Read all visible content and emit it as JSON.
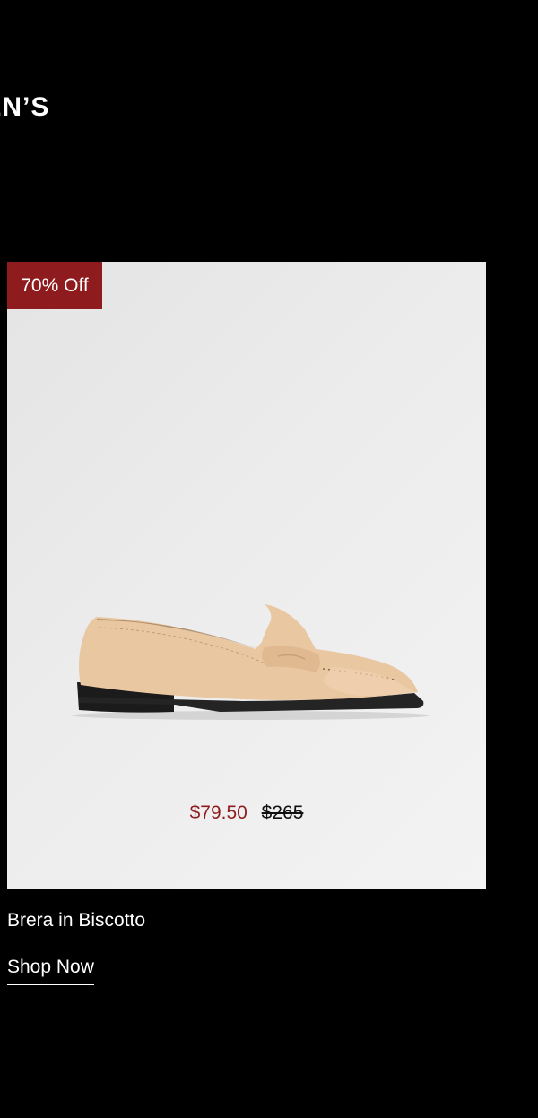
{
  "section": {
    "title": "IEN’S"
  },
  "product": {
    "badge": "70% Off",
    "name": "Brera in Biscotto",
    "price_sale": "$79.50",
    "price_original": "$265",
    "cta": "Shop Now",
    "image_icon": "loafer-shoe-image"
  },
  "colors": {
    "background": "#000000",
    "accent_red": "#8e1c1f",
    "card_background": "#ececec",
    "text_on_dark": "#ffffff"
  }
}
